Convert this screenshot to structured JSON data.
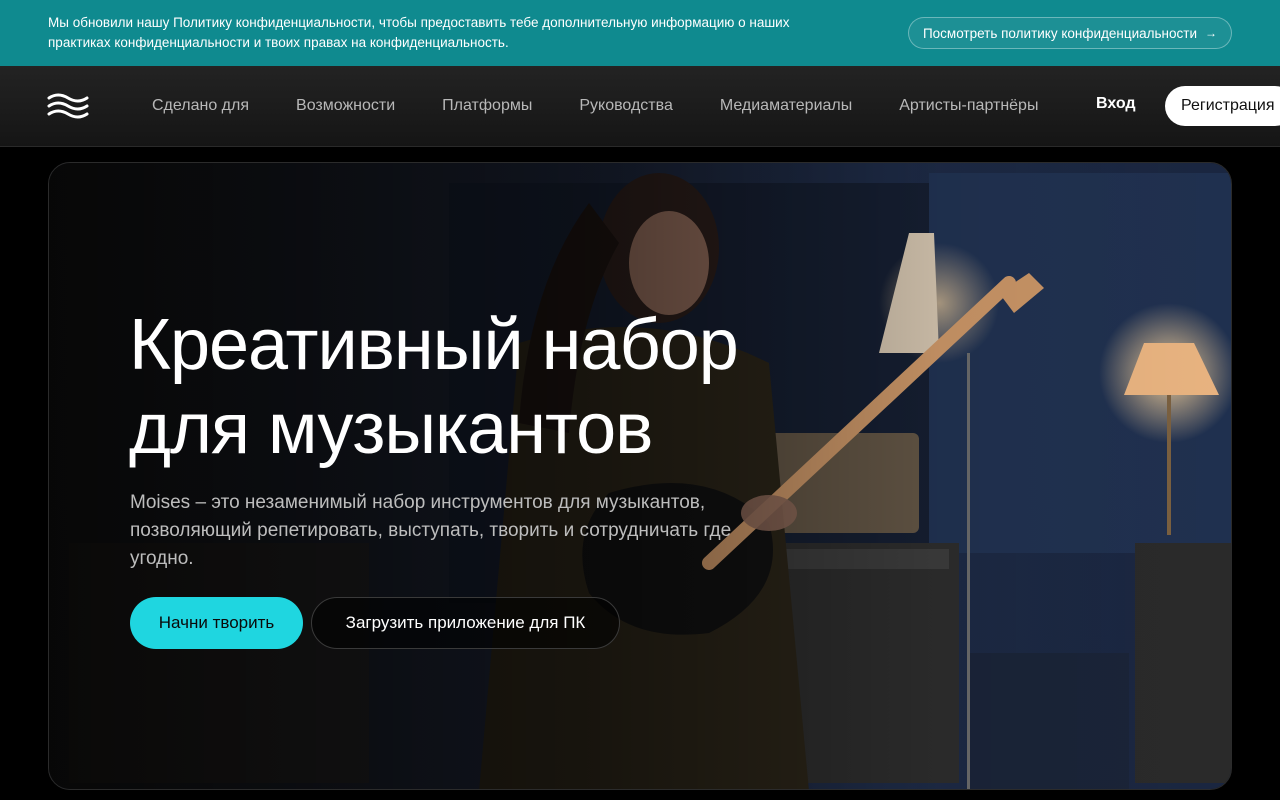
{
  "banner": {
    "text": "Мы обновили нашу Политику конфиденциальности, чтобы предоставить тебе дополнительную информацию о наших практиках конфиденциальности и твоих правах на конфиденциальность.",
    "button_label": "Посмотреть политику конфиденциальности",
    "button_icon": "arrow-right-icon"
  },
  "nav": {
    "logo": "moises-logo",
    "items": [
      {
        "label": "Сделано для"
      },
      {
        "label": "Возможности"
      },
      {
        "label": "Платформы"
      },
      {
        "label": "Руководства"
      },
      {
        "label": "Медиаматериалы"
      },
      {
        "label": "Артисты-партнёры"
      }
    ],
    "login_label": "Вход",
    "register_label": "Регистрация"
  },
  "hero": {
    "title_line1": "Креативный набор",
    "title_line2": "для музыкантов",
    "description": "Moises – это незаменимый набор инструментов для музыкантов, позволяющий репетировать, выступать, творить и сотрудничать где угодно.",
    "primary_button": "Начни творить",
    "secondary_button": "Загрузить приложение для ПК",
    "image": "guitarist-in-studio-photo"
  },
  "colors": {
    "banner_bg": "#0f8a8f",
    "primary_accent": "#1fd6e0",
    "page_bg": "#000000"
  }
}
